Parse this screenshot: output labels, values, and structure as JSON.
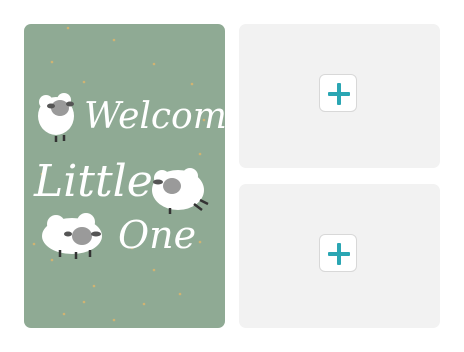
{
  "card": {
    "line1": "Welcome",
    "line2": "Little",
    "line3": "One"
  },
  "slots": [
    {
      "icon": "plus-icon"
    },
    {
      "icon": "plus-icon"
    }
  ],
  "colors": {
    "card_background": "#8faa94",
    "slot_background": "#f2f2f2",
    "plus_accent": "#2aa6b3"
  }
}
